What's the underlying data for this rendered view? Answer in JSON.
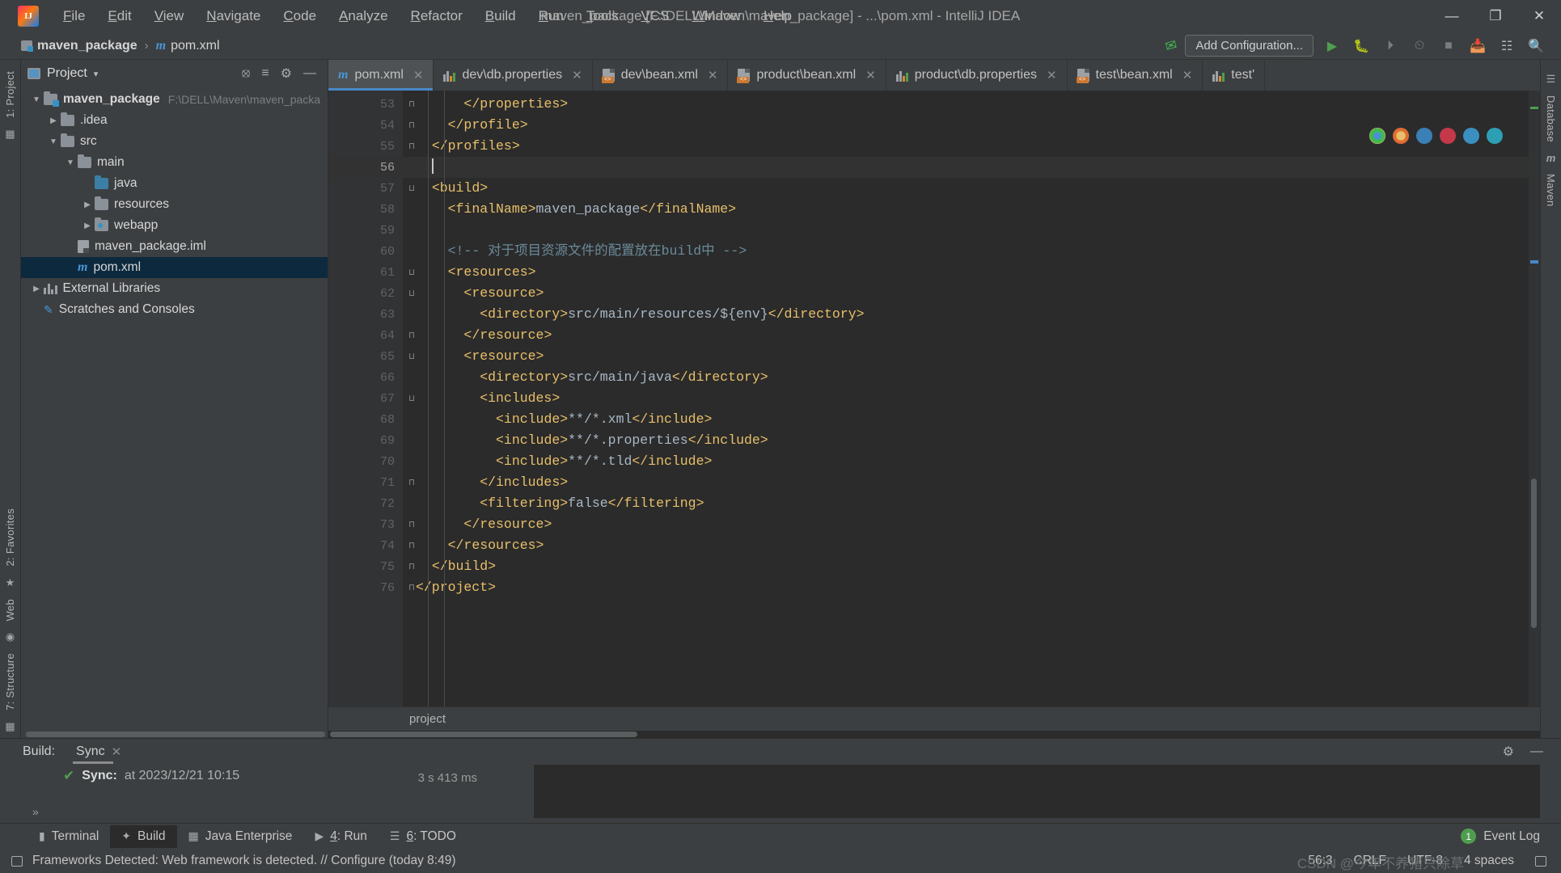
{
  "window": {
    "title": "maven_package [F:\\DELL\\Maven\\maven_package] - ...\\pom.xml - IntelliJ IDEA",
    "minimize": "—",
    "maximize": "❐",
    "close": "✕"
  },
  "menubar": [
    {
      "label": "File"
    },
    {
      "label": "Edit"
    },
    {
      "label": "View"
    },
    {
      "label": "Navigate"
    },
    {
      "label": "Code"
    },
    {
      "label": "Analyze"
    },
    {
      "label": "Refactor"
    },
    {
      "label": "Build"
    },
    {
      "label": "Run"
    },
    {
      "label": "Tools"
    },
    {
      "label": "VCS"
    },
    {
      "label": "Window"
    },
    {
      "label": "Help"
    }
  ],
  "navbar": {
    "breadcrumb": [
      {
        "label": "maven_package"
      },
      {
        "label": "pom.xml"
      }
    ],
    "separator": "›",
    "add_configuration": "Add Configuration...",
    "icons": [
      "hammer-icon",
      "run-icon",
      "debug-icon",
      "coverage-icon",
      "profile-icon",
      "stop-icon",
      "git-update-icon",
      "settings-icon",
      "search-icon"
    ]
  },
  "left_strip": {
    "project_label": "1: Project",
    "favorites_label": "2: Favorites",
    "web_label": "Web",
    "structure_label": "7: Structure"
  },
  "right_strip": {
    "database_label": "Database",
    "maven_label": "Maven"
  },
  "project_panel": {
    "title": "Project",
    "caret": "▾",
    "actions": [
      "locate-icon",
      "collapse-all-icon",
      "settings-icon",
      "hide-icon"
    ],
    "tree": [
      {
        "label": "maven_package",
        "detail": "F:\\DELL\\Maven\\maven_packa",
        "indent": 0,
        "arrow": "▼",
        "icon": "module-folder-icon",
        "bold": true,
        "selected": false
      },
      {
        "label": ".idea",
        "detail": "",
        "indent": 1,
        "arrow": "▶",
        "icon": "folder-icon",
        "bold": false,
        "selected": false
      },
      {
        "label": "src",
        "detail": "",
        "indent": 1,
        "arrow": "▼",
        "icon": "folder-icon",
        "bold": false,
        "selected": false
      },
      {
        "label": "main",
        "detail": "",
        "indent": 2,
        "arrow": "▼",
        "icon": "folder-icon",
        "bold": false,
        "selected": false
      },
      {
        "label": "java",
        "detail": "",
        "indent": 3,
        "arrow": "",
        "icon": "source-folder-icon",
        "bold": false,
        "selected": false
      },
      {
        "label": "resources",
        "detail": "",
        "indent": 3,
        "arrow": "▶",
        "icon": "folder-icon",
        "bold": false,
        "selected": false
      },
      {
        "label": "webapp",
        "detail": "",
        "indent": 3,
        "arrow": "▶",
        "icon": "webapp-folder-icon",
        "bold": false,
        "selected": false
      },
      {
        "label": "maven_package.iml",
        "detail": "",
        "indent": 2,
        "arrow": "",
        "icon": "iml-file-icon",
        "bold": false,
        "selected": false
      },
      {
        "label": "pom.xml",
        "detail": "",
        "indent": 2,
        "arrow": "",
        "icon": "maven-file-icon",
        "bold": false,
        "selected": true
      },
      {
        "label": "External Libraries",
        "detail": "",
        "indent": 0,
        "arrow": "▶",
        "icon": "libraries-icon",
        "bold": false,
        "selected": false
      },
      {
        "label": "Scratches and Consoles",
        "detail": "",
        "indent": 0,
        "arrow": "",
        "icon": "scratches-icon",
        "bold": false,
        "selected": false
      }
    ]
  },
  "editor_tabs": [
    {
      "label": "pom.xml",
      "icon": "maven-file-icon",
      "active": true,
      "close": "✕"
    },
    {
      "label": "dev\\db.properties",
      "icon": "properties-file-icon",
      "active": false,
      "close": "✕"
    },
    {
      "label": "dev\\bean.xml",
      "icon": "xml-file-icon",
      "active": false,
      "close": "✕"
    },
    {
      "label": "product\\bean.xml",
      "icon": "xml-file-icon",
      "active": false,
      "close": "✕"
    },
    {
      "label": "product\\db.properties",
      "icon": "properties-file-icon",
      "active": false,
      "close": "✕"
    },
    {
      "label": "test\\bean.xml",
      "icon": "xml-file-icon",
      "active": false,
      "close": "✕"
    },
    {
      "label": "test'",
      "icon": "properties-file-icon",
      "active": false,
      "close": ""
    }
  ],
  "editor": {
    "first_line_number": 53,
    "current_line": 56,
    "breadcrumb_bottom": "project",
    "lines": [
      {
        "n": 53,
        "fold": "⊓",
        "html": "      <span class='t'>&lt;/properties&gt;</span>"
      },
      {
        "n": 54,
        "fold": "⊓",
        "html": "    <span class='t'>&lt;/profile&gt;</span>"
      },
      {
        "n": 55,
        "fold": "⊓",
        "html": "  <span class='t'>&lt;/profiles&gt;</span>"
      },
      {
        "n": 56,
        "fold": "",
        "html": "  <span class='caret-bar'></span>"
      },
      {
        "n": 57,
        "fold": "⊔",
        "html": "  <span class='t'>&lt;build&gt;</span>"
      },
      {
        "n": 58,
        "fold": "",
        "html": "    <span class='t'>&lt;finalName&gt;</span><span class='v'>maven_package</span><span class='t'>&lt;/finalName&gt;</span>"
      },
      {
        "n": 59,
        "fold": "",
        "html": ""
      },
      {
        "n": 60,
        "fold": "",
        "html": "    <span class='cmx'>&lt;!-- 对于项目资源文件的配置放在build中 --&gt;</span>"
      },
      {
        "n": 61,
        "fold": "⊔",
        "html": "    <span class='t'>&lt;resources&gt;</span>"
      },
      {
        "n": 62,
        "fold": "⊔",
        "html": "      <span class='t'>&lt;resource&gt;</span>"
      },
      {
        "n": 63,
        "fold": "",
        "html": "        <span class='t'>&lt;directory&gt;</span><span class='v'>src/main/resources/${env}</span><span class='t'>&lt;/directory&gt;</span>"
      },
      {
        "n": 64,
        "fold": "⊓",
        "html": "      <span class='t'>&lt;/resource&gt;</span>"
      },
      {
        "n": 65,
        "fold": "⊔",
        "html": "      <span class='t'>&lt;resource&gt;</span>"
      },
      {
        "n": 66,
        "fold": "",
        "html": "        <span class='t'>&lt;directory&gt;</span><span class='v'>src/main/java</span><span class='t'>&lt;/directory&gt;</span>"
      },
      {
        "n": 67,
        "fold": "⊔",
        "html": "        <span class='t'>&lt;includes&gt;</span>"
      },
      {
        "n": 68,
        "fold": "",
        "html": "          <span class='t'>&lt;include&gt;</span><span class='v'>**/*.xml</span><span class='t'>&lt;/include&gt;</span>"
      },
      {
        "n": 69,
        "fold": "",
        "html": "          <span class='t'>&lt;include&gt;</span><span class='v'>**/*.properties</span><span class='t'>&lt;/include&gt;</span>"
      },
      {
        "n": 70,
        "fold": "",
        "html": "          <span class='t'>&lt;include&gt;</span><span class='v'>**/*.tld</span><span class='t'>&lt;/include&gt;</span>"
      },
      {
        "n": 71,
        "fold": "⊓",
        "html": "        <span class='t'>&lt;/includes&gt;</span>"
      },
      {
        "n": 72,
        "fold": "",
        "html": "        <span class='t'>&lt;filtering&gt;</span><span class='v'>false</span><span class='t'>&lt;/filtering&gt;</span>"
      },
      {
        "n": 73,
        "fold": "⊓",
        "html": "      <span class='t'>&lt;/resource&gt;</span>"
      },
      {
        "n": 74,
        "fold": "⊓",
        "html": "    <span class='t'>&lt;/resources&gt;</span>"
      },
      {
        "n": 75,
        "fold": "⊓",
        "html": "  <span class='t'>&lt;/build&gt;</span>"
      },
      {
        "n": 76,
        "fold": "⊓",
        "html": "<span class='t'>&lt;/project&gt;</span>"
      }
    ],
    "browser_icons": [
      "chrome-icon",
      "firefox-icon",
      "safari-icon",
      "opera-icon",
      "edge-icon",
      "ie-icon"
    ]
  },
  "build_panel": {
    "label": "Build:",
    "tab": "Sync",
    "tab_close": "✕",
    "status_icon": "check-icon",
    "sync_title": "Sync:",
    "sync_detail": "at 2023/12/21 10:15",
    "duration": "3 s 413 ms",
    "settings_icon": "gear-icon",
    "minimize_icon": "minimize-icon",
    "expand_left": "»",
    "expand_right": "»"
  },
  "bottom_toolbar": [
    {
      "label": "Terminal",
      "icon": "terminal-icon",
      "active": false,
      "num": ""
    },
    {
      "label": "Build",
      "icon": "build-hammer-icon",
      "active": true,
      "num": ""
    },
    {
      "label": "Java Enterprise",
      "icon": "java-ee-icon",
      "active": false,
      "num": ""
    },
    {
      "label": "4: Run",
      "icon": "run-icon",
      "active": false,
      "num": "4"
    },
    {
      "label": "6: TODO",
      "icon": "todo-icon",
      "active": false,
      "num": "6"
    }
  ],
  "event_log": {
    "count": "1",
    "label": "Event Log"
  },
  "statusbar": {
    "message": "Frameworks Detected: Web framework is detected. // Configure (today 8:49)",
    "caret_position": "56:3",
    "line_separator": "CRLF",
    "encoding": "UTF-8",
    "indent": "4 spaces",
    "watermark": "CSDN @今年不养猪只除草",
    "lock_icon": "lock-icon"
  },
  "colors": {
    "accent_blue": "#4a88c7",
    "selection": "#0d293e",
    "editor_bg": "#2b2b2b",
    "panel_bg": "#3c3f41",
    "tag": "#e8bf6a",
    "value": "#a9b7c6",
    "comment": "#6a8a9a",
    "green": "#4f9e4f"
  }
}
